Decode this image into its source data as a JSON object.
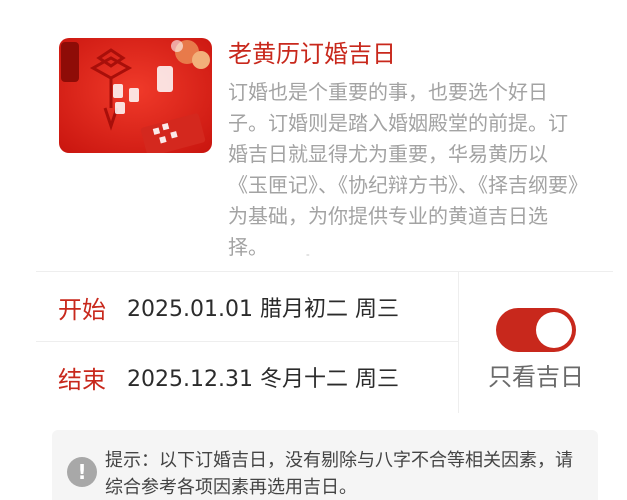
{
  "header": {
    "title": "老黄历订婚吉日",
    "description": "订婚也是个重要的事，也要选个好日子。订婚则是踏入婚姻殿堂的前提。订婚吉日就显得尤为重要，华易黄历以《玉匣记》、《协纪辩方书》、《择吉纲要》为基础，为你提供专业的黄道吉日选择。",
    "image_alt": "red-wedding-table-photo"
  },
  "date_range": {
    "start_label": "开始",
    "start_value": "2025.01.01 腊月初二 周三",
    "end_label": "结束",
    "end_value": "2025.12.31 冬月十二 周三"
  },
  "filter": {
    "toggle_on": true,
    "label": "只看吉日"
  },
  "tip": {
    "icon": "exclamation-icon",
    "text": "提示：以下订婚吉日，没有剔除与八字不合等相关因素，请综合参考各项因素再选用吉日。"
  },
  "colors": {
    "accent": "#c8281c",
    "muted_text": "#a3a3a3",
    "tip_bg": "#f5f5f5"
  }
}
